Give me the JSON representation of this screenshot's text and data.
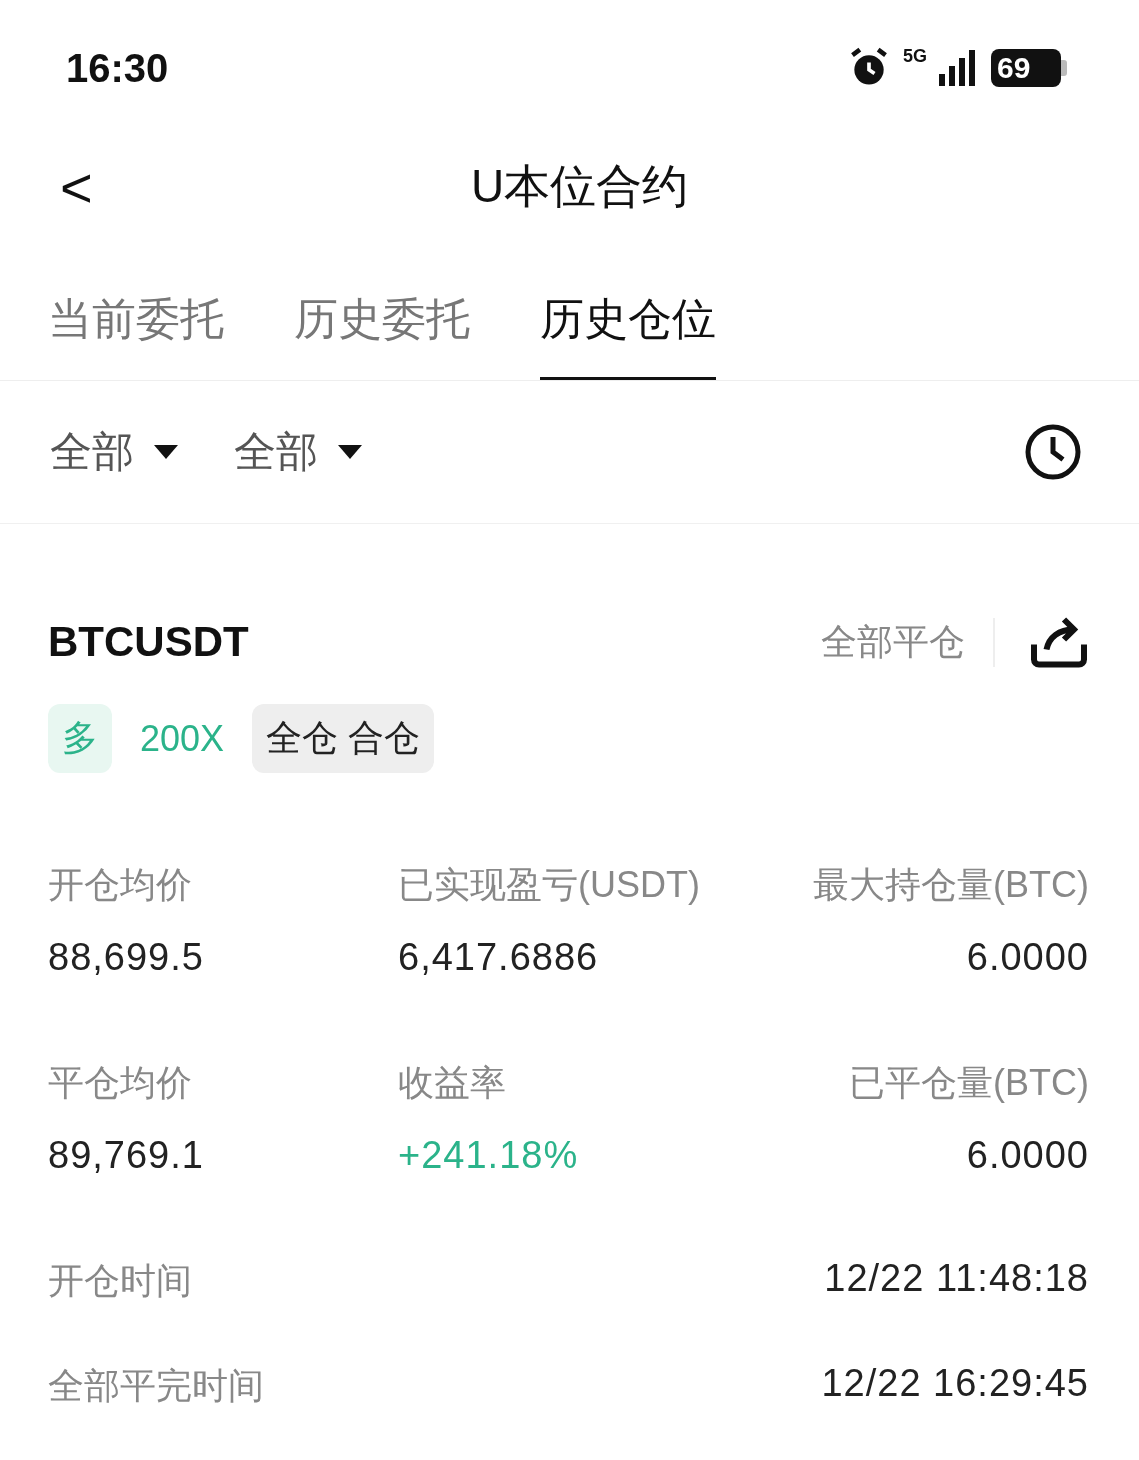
{
  "status_bar": {
    "time": "16:30",
    "network": "5G",
    "battery": "69"
  },
  "header": {
    "back": "<",
    "title": "U本位合约"
  },
  "tabs": [
    {
      "label": "当前委托",
      "selected": false
    },
    {
      "label": "历史委托",
      "selected": false
    },
    {
      "label": "历史仓位",
      "selected": true
    }
  ],
  "filters": [
    {
      "label": "全部"
    },
    {
      "label": "全部"
    }
  ],
  "position": {
    "symbol": "BTCUSDT",
    "close_all": "全部平仓",
    "tags": [
      {
        "kind": "side",
        "text": "多"
      },
      {
        "kind": "leverage",
        "text": "200X"
      },
      {
        "kind": "mode",
        "text": "全仓 合仓"
      }
    ],
    "stats": [
      {
        "label": "开仓均价",
        "value": "88,699.5",
        "positive": false
      },
      {
        "label": "已实现盈亏(USDT)",
        "value": "6,417.6886",
        "positive": false
      },
      {
        "label": "最大持仓量(BTC)",
        "value": "6.0000",
        "positive": false
      },
      {
        "label": "平仓均价",
        "value": "89,769.1",
        "positive": false
      },
      {
        "label": "收益率",
        "value": "+241.18%",
        "positive": true
      },
      {
        "label": "已平仓量(BTC)",
        "value": "6.0000",
        "positive": false
      }
    ],
    "times": [
      {
        "label": "开仓时间",
        "value": "12/22 11:48:18"
      },
      {
        "label": "全部平完时间",
        "value": "12/22 16:29:45"
      }
    ]
  }
}
